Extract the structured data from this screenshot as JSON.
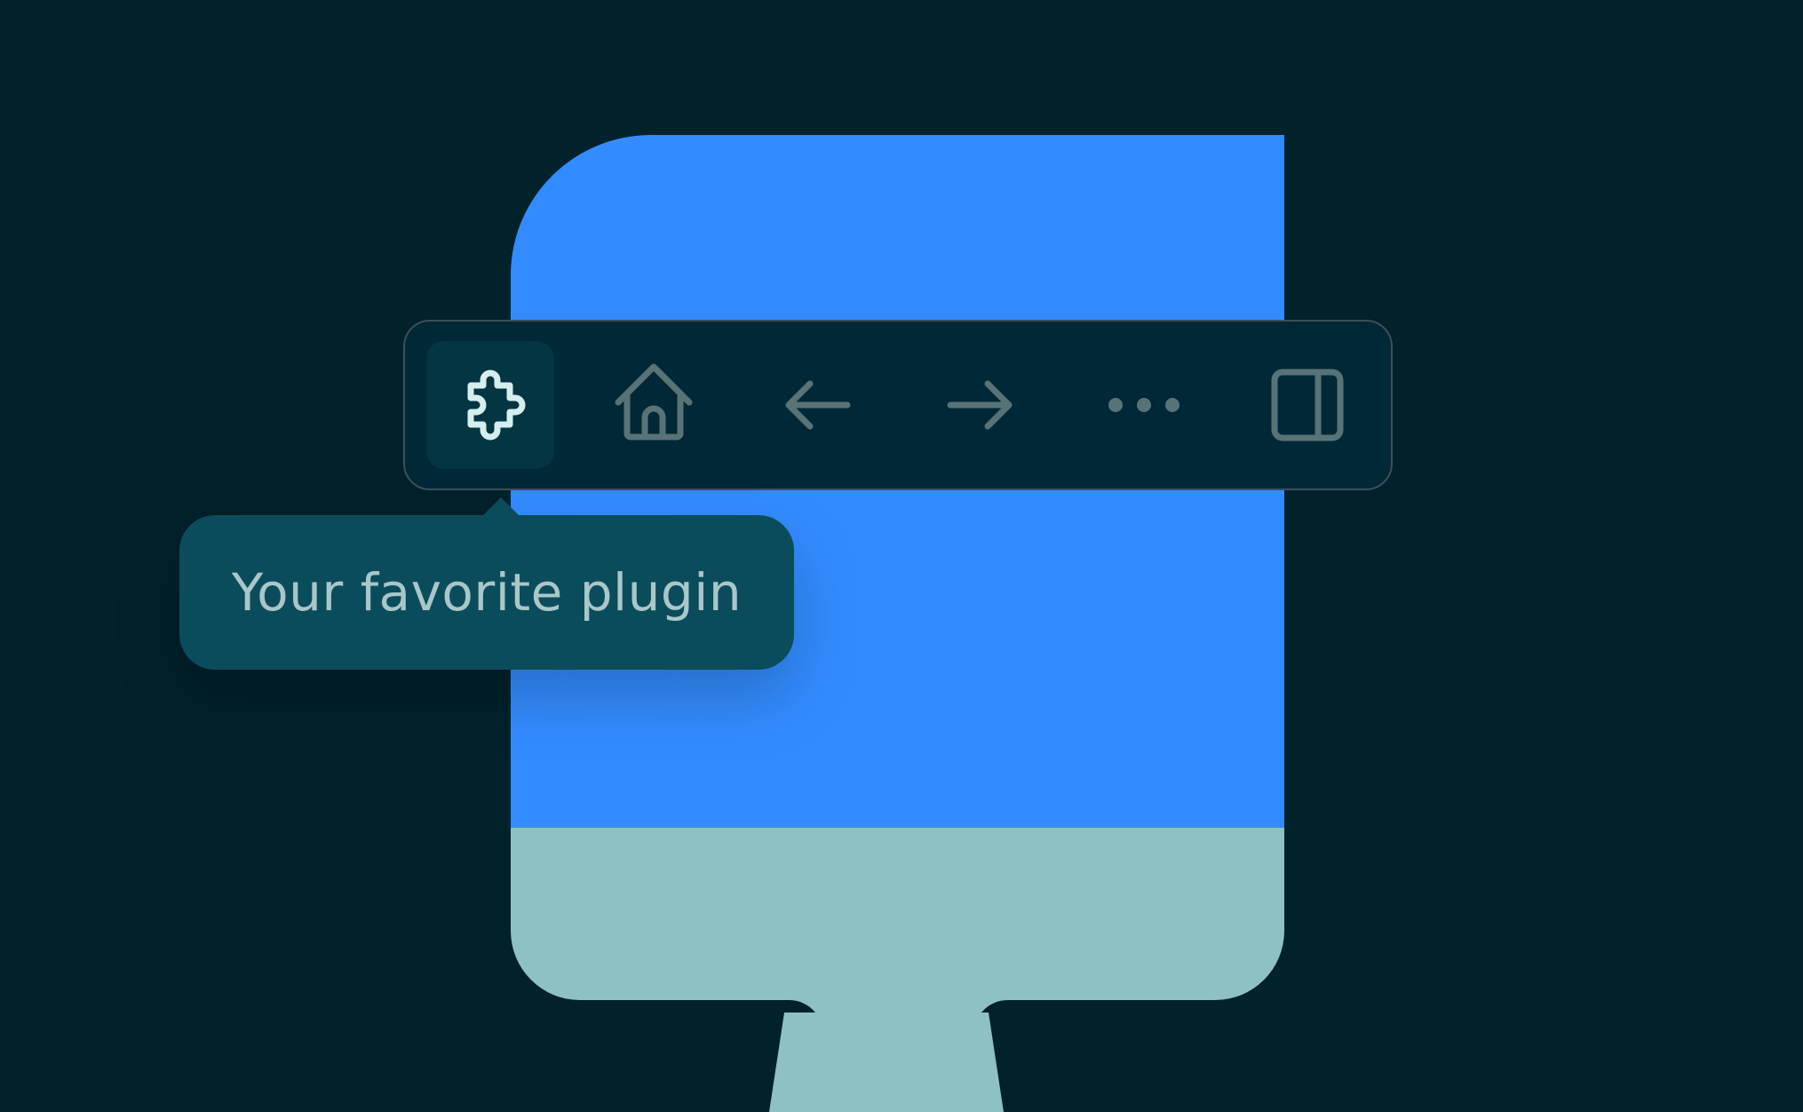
{
  "colors": {
    "background": "#01212b",
    "paddle_blue": "#338cff",
    "paddle_handle": "#8ec1c3",
    "toolbar_bg": "#012836",
    "toolbar_border": "#3d4f57",
    "active_tool_bg": "#033542",
    "active_icon": "#d5eeee",
    "inactive_icon": "#587377",
    "tooltip_bg": "#0b4c5c",
    "tooltip_text": "#a9c6c9"
  },
  "toolbar": {
    "tools": [
      {
        "icon": "puzzle-piece-icon",
        "active": true
      },
      {
        "icon": "home-icon",
        "active": false
      },
      {
        "icon": "arrow-left-icon",
        "active": false
      },
      {
        "icon": "arrow-right-icon",
        "active": false
      },
      {
        "icon": "more-dots-icon",
        "active": false
      },
      {
        "icon": "sidebar-panel-icon",
        "active": false
      }
    ]
  },
  "tooltip": {
    "text": "Your favorite plugin"
  }
}
